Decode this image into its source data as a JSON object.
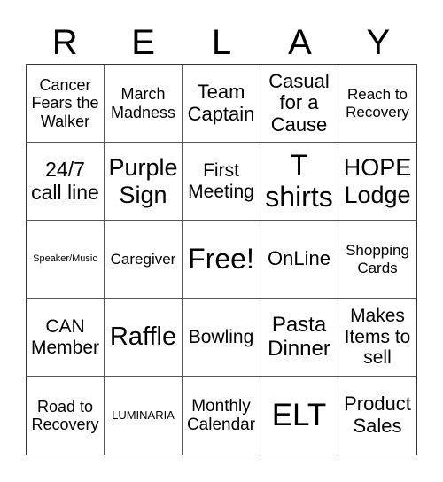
{
  "title_letters": [
    "R",
    "E",
    "L",
    "A",
    "Y"
  ],
  "cells": [
    {
      "text": "Cancer Fears the Walker",
      "size": 18
    },
    {
      "text": "March Madness",
      "size": 18
    },
    {
      "text": "Team Captain",
      "size": 22
    },
    {
      "text": "Casual for a Cause",
      "size": 22
    },
    {
      "text": "Reach to Recovery",
      "size": 17
    },
    {
      "text": "24/7 call line",
      "size": 23
    },
    {
      "text": "Purple Sign",
      "size": 27
    },
    {
      "text": "First Meeting",
      "size": 21
    },
    {
      "text": "T shirts",
      "size": 32
    },
    {
      "text": "HOPE Lodge",
      "size": 27
    },
    {
      "text": "Speaker/Music",
      "size": 11
    },
    {
      "text": "Caregiver",
      "size": 17
    },
    {
      "text": "Free!",
      "size": 32
    },
    {
      "text": "OnLine",
      "size": 22
    },
    {
      "text": "Shopping Cards",
      "size": 17
    },
    {
      "text": "CAN Member",
      "size": 21
    },
    {
      "text": "Raffle",
      "size": 29
    },
    {
      "text": "Bowling",
      "size": 21
    },
    {
      "text": "Pasta Dinner",
      "size": 24
    },
    {
      "text": "Makes Items to sell",
      "size": 21
    },
    {
      "text": "Road to Recovery",
      "size": 18
    },
    {
      "text": "LUMINARIA",
      "size": 13
    },
    {
      "text": "Monthly Calendar",
      "size": 19
    },
    {
      "text": "ELT",
      "size": 35
    },
    {
      "text": "Product Sales",
      "size": 22
    }
  ]
}
